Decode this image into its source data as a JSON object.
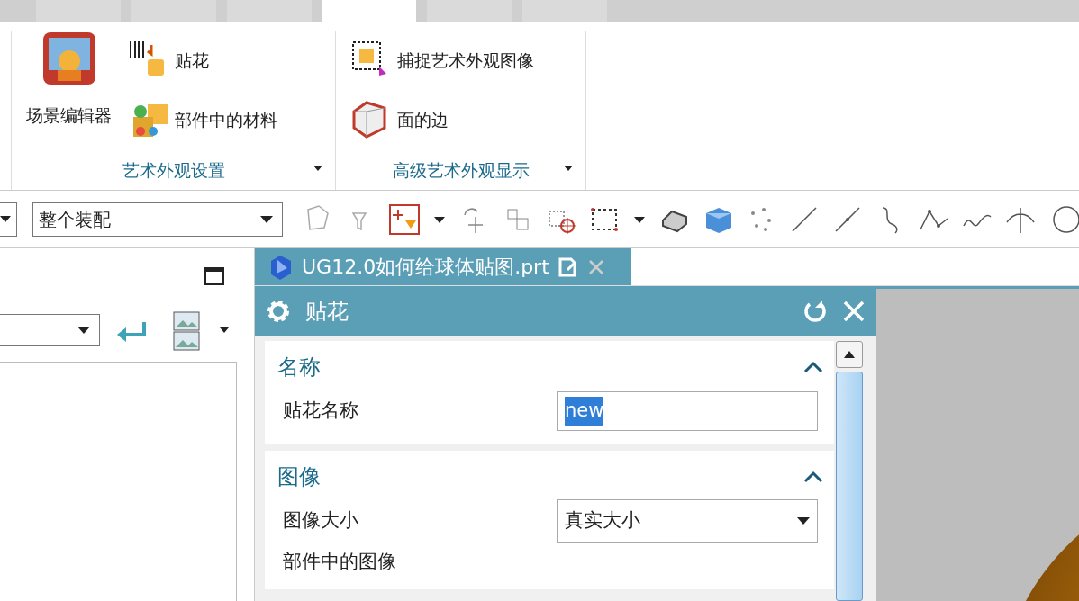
{
  "ribbon_tabs": [
    {
      "selected": false
    },
    {
      "selected": false
    },
    {
      "selected": false
    },
    {
      "selected": true
    },
    {
      "selected": false
    },
    {
      "selected": false
    }
  ],
  "ribbon_groups": [
    {
      "label": "艺术外观设置",
      "large_button": "场景编辑器",
      "buttons": [
        "贴花",
        "部件中的材料"
      ]
    },
    {
      "label": "高级艺术外观显示",
      "buttons": [
        "捕捉艺术外观图像",
        "面的边"
      ]
    }
  ],
  "toolbar": {
    "filter_select": "整个装配"
  },
  "document_tab": {
    "title": "UG12.0如何给球体贴图.prt"
  },
  "dialog": {
    "title": "贴花",
    "sections": [
      {
        "title": "名称",
        "expanded": true,
        "rows": [
          {
            "kind": "text",
            "label": "贴花名称",
            "value": "new",
            "value_selected": true
          }
        ]
      },
      {
        "title": "图像",
        "expanded": true,
        "rows": [
          {
            "kind": "select",
            "label": "图像大小",
            "value": "真实大小"
          },
          {
            "kind": "label",
            "label": "部件中的图像"
          }
        ]
      }
    ]
  }
}
